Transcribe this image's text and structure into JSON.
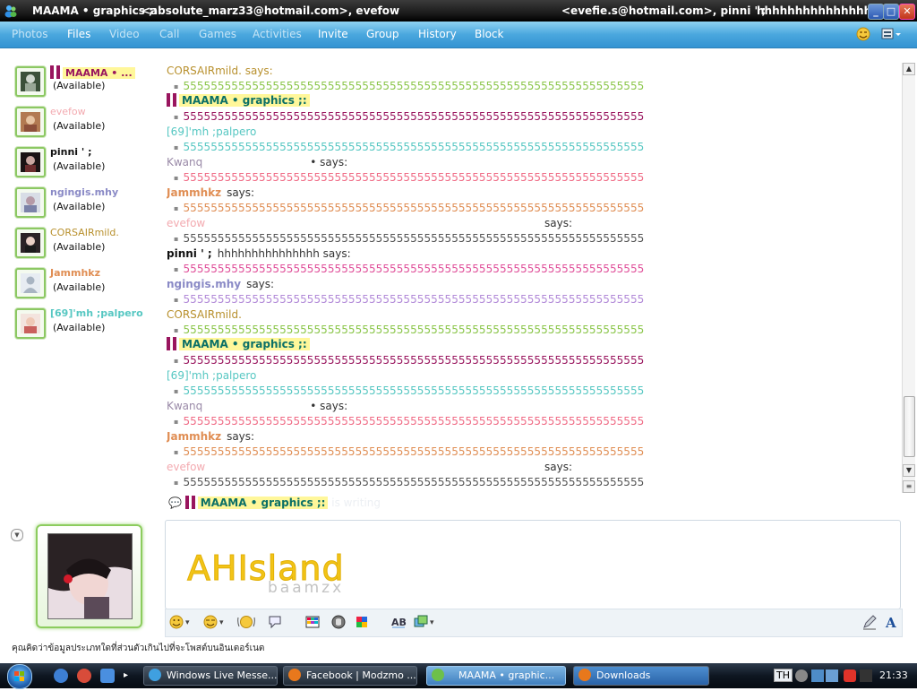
{
  "window": {
    "title_group": "MAAMA • graphics ;:",
    "title_email_1": "<absolute_marz33@hotmail.com>, evefow",
    "title_email_2": "<evefie.s@hotmail.com>, pinni ' ;",
    "title_extra": "hhhhhhhhhhhhhhh ...",
    "minimize": "_",
    "maximize": "□",
    "close": "✕"
  },
  "menu": {
    "photos": "Photos",
    "files": "Files",
    "video": "Video",
    "call": "Call",
    "games": "Games",
    "activities": "Activities",
    "invite": "Invite",
    "group": "Group",
    "history": "History",
    "block": "Block"
  },
  "contacts": [
    {
      "name": "MAAMA • ...",
      "status": "(Available)",
      "color": "#99155e"
    },
    {
      "name": "evefow",
      "status": "(Available)",
      "color": "#f3aab0"
    },
    {
      "name": "pinni ' ;",
      "status": "(Available)",
      "color": "#111111"
    },
    {
      "name": "ngingis.mhy",
      "status": "(Available)",
      "color": "#8a8ac6"
    },
    {
      "name": "CORSAIRmild.",
      "status": "(Available)",
      "color": "#b8902d"
    },
    {
      "name": "Jammhkz",
      "status": "(Available)",
      "color": "#e08e54"
    },
    {
      "name": "[69]'mh ;palpero",
      "status": "(Available)",
      "color": "#56c7c2"
    }
  ],
  "conversation": {
    "says": "says:",
    "lines": [
      {
        "kind": "name",
        "text": "CORSAIRmild. says:",
        "color": "#b8902d"
      },
      {
        "kind": "msg",
        "text": "5555555555555555555555555555555555555555555555555555555555555555555",
        "color": "#8bc64a"
      },
      {
        "kind": "name",
        "text": "MAAMA • graphics ;:",
        "color": "#0b6f66",
        "group": true
      },
      {
        "kind": "msg",
        "text": "5555555555555555555555555555555555555555555555555555555555555555555",
        "color": "#99155e"
      },
      {
        "kind": "name",
        "text": "[69]'mh ;palpero",
        "color": "#56c7c2"
      },
      {
        "kind": "msg",
        "text": "5555555555555555555555555555555555555555555555555555555555555555555",
        "color": "#56c7c2"
      },
      {
        "kind": "name",
        "text": "Kwanq",
        "trail": "• says:",
        "color": "#9a8aa8"
      },
      {
        "kind": "msg",
        "text": "5555555555555555555555555555555555555555555555555555555555555555555",
        "color": "#f06c86"
      },
      {
        "kind": "name",
        "text": "Jammhkz",
        "trail": "says:",
        "color": "#e08e54"
      },
      {
        "kind": "msg",
        "text": "5555555555555555555555555555555555555555555555555555555555555555555",
        "color": "#e08e54"
      },
      {
        "kind": "name",
        "text": "evefow",
        "trail": "says:",
        "color": "#f3aab0",
        "farsays": true
      },
      {
        "kind": "msg",
        "text": "5555555555555555555555555555555555555555555555555555555555555555555",
        "color": "#555555"
      },
      {
        "kind": "name",
        "text": "pinni ' ;",
        "trail": "hhhhhhhhhhhhhhh says:",
        "color": "#111111"
      },
      {
        "kind": "msg",
        "text": "5555555555555555555555555555555555555555555555555555555555555555555",
        "color": "#e0509a"
      },
      {
        "kind": "name",
        "text": "ngingis.mhy",
        "trail": "says:",
        "color": "#8a8ac6"
      },
      {
        "kind": "msg",
        "text": "5555555555555555555555555555555555555555555555555555555555555555555",
        "color": "#b28ad8"
      },
      {
        "kind": "name",
        "text": "CORSAIRmild.",
        "color": "#b8902d"
      },
      {
        "kind": "msg",
        "text": "5555555555555555555555555555555555555555555555555555555555555555555",
        "color": "#8bc64a"
      },
      {
        "kind": "name",
        "text": "MAAMA • graphics ;:",
        "color": "#0b6f66",
        "group": true
      },
      {
        "kind": "msg",
        "text": "5555555555555555555555555555555555555555555555555555555555555555555",
        "color": "#99155e"
      },
      {
        "kind": "name",
        "text": "[69]'mh ;palpero",
        "color": "#56c7c2"
      },
      {
        "kind": "msg",
        "text": "5555555555555555555555555555555555555555555555555555555555555555555",
        "color": "#56c7c2"
      },
      {
        "kind": "name",
        "text": "Kwanq",
        "trail": "• says:",
        "color": "#9a8aa8"
      },
      {
        "kind": "msg",
        "text": "5555555555555555555555555555555555555555555555555555555555555555555",
        "color": "#f06c86"
      },
      {
        "kind": "name",
        "text": "Jammhkz",
        "trail": "says:",
        "color": "#e08e54"
      },
      {
        "kind": "msg",
        "text": "5555555555555555555555555555555555555555555555555555555555555555555",
        "color": "#e08e54"
      },
      {
        "kind": "name",
        "text": "evefow",
        "trail": "says:",
        "color": "#f3aab0",
        "farsays": true
      },
      {
        "kind": "msg",
        "text": "5555555555555555555555555555555555555555555555555555555555555555555",
        "color": "#555555"
      }
    ]
  },
  "typing": {
    "name": "MAAMA • graphics ;:",
    "note": "is writing"
  },
  "input": {
    "handwriting": "AHIsland",
    "sub": "baamzx"
  },
  "status_message": "คุณคิดว่าข้อมูลประเภทใดที่ส่วนตัวเกินไปที่จะโพสต์บนอินเตอร์เนต",
  "taskbar": {
    "tasks": [
      {
        "label": "Windows Live Messe...",
        "icon_color": "#3fa0e0"
      },
      {
        "label": "Facebook | Modzmo ...",
        "icon_color": "#e8781c"
      },
      {
        "label": "MAAMA • graphic...",
        "icon_color": "#6dc04a",
        "active": true
      },
      {
        "label": "Downloads",
        "icon_color": "#e8781c"
      }
    ],
    "lang": "TH",
    "clock": "21:33"
  }
}
